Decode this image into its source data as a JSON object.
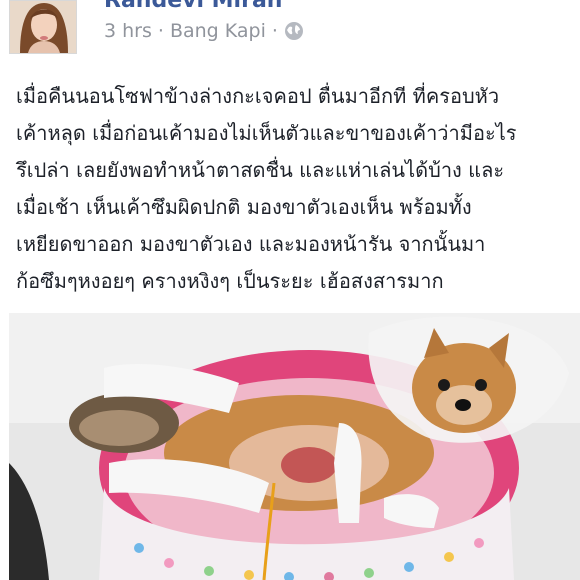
{
  "post": {
    "author_name": "Randevi Miran",
    "timestamp": "3 hrs",
    "separator": "·",
    "location": "Bang Kapi",
    "audience_separator": "·",
    "audience_icon": "globe-icon",
    "body_lines": [
      "เมื่อคืนนอนโซฟาข้างล่างกะเจคอป ตื่นมาอีกที ที่ครอบหัว",
      "เค้าหลุด เมื่อก่อนเค้ามองไม่เห็นตัวและขาของเค้าว่ามีอะไร",
      "รึเปล่า เลยยังพอทำหน้าตาสดชื่น และแห่าเล่นได้บ้าง และ",
      "เมื่อเช้า เห็นเค้าซึมผิดปกติ มองขาตัวเองเห็น พร้อมทั้ง",
      "เหยียดขาออก มองขาตัวเอง และมองหน้ารัน จากนั้นมา",
      "ก้อซึมๆหงอยๆ ครางหงิงๆ เป็นระยะ เฮ้อสงสารมาก"
    ]
  },
  "colors": {
    "author": "#3b5998",
    "meta": "#90949c",
    "text": "#1d2129",
    "bed_pink": "#e0457b",
    "dog_fur": "#c98a47"
  }
}
